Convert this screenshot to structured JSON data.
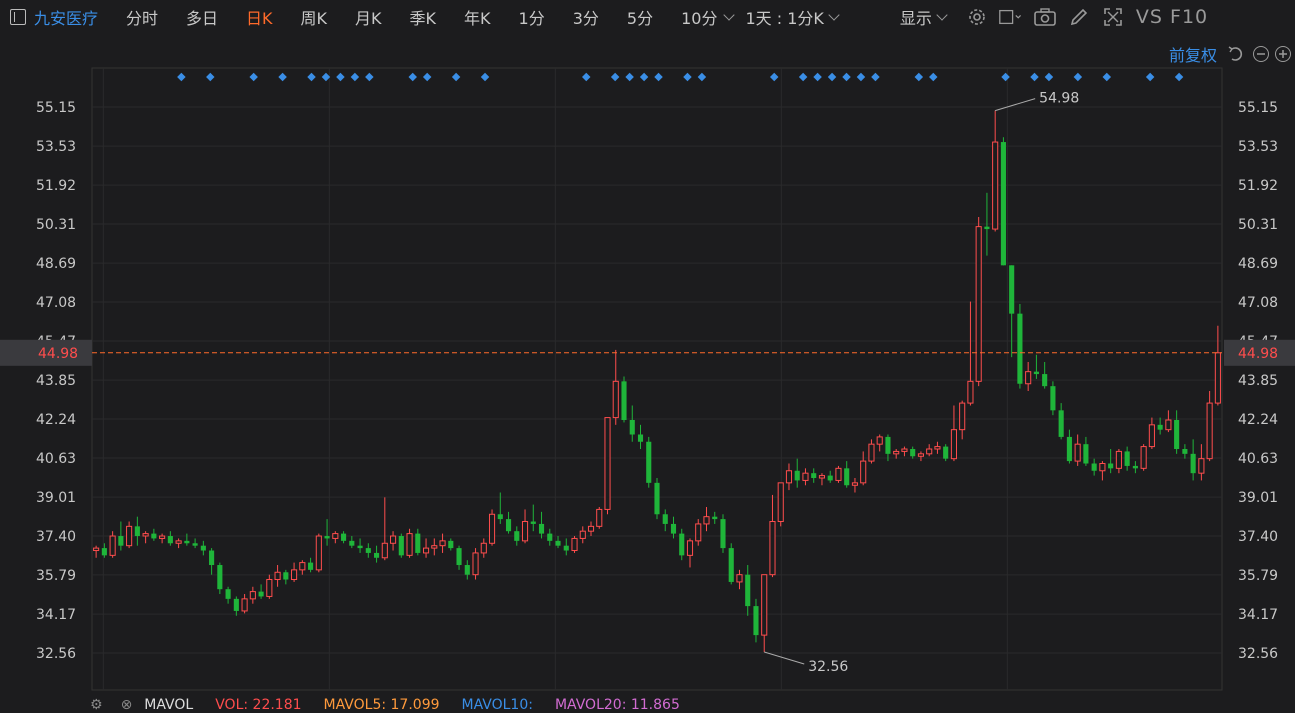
{
  "toolbar": {
    "stock_name": "九安医疗",
    "tabs": [
      "分时",
      "多日",
      "日K",
      "周K",
      "月K",
      "季K",
      "年K",
      "1分",
      "3分",
      "5分",
      "10分"
    ],
    "active_tab": "日K",
    "interval": "1天 : 1分K",
    "display": "显示",
    "f10": "VS F10"
  },
  "adjust": {
    "label": "前复权"
  },
  "colors": {
    "up": "#ff4d4d",
    "down": "#1fb53a",
    "marker": "#3a8ee6",
    "last": "#ff6a2a"
  },
  "volume_bar": {
    "mavol": "MAVOL",
    "vol": "VOL: 22.181",
    "mavol5": "MAVOL5: 17.099",
    "mavol10": "MAVOL10:",
    "mavol20": "MAVOL20: 11.865"
  },
  "chart_data": {
    "type": "candlestick",
    "y_ticks": [
      "55.15",
      "53.53",
      "51.92",
      "50.31",
      "48.69",
      "47.08",
      "45.47",
      "43.85",
      "42.24",
      "40.63",
      "39.01",
      "37.40",
      "35.79",
      "34.17",
      "32.56"
    ],
    "ylim": [
      32.56,
      55.15
    ],
    "last_price": "44.98",
    "high_label": "54.98",
    "low_label": "32.56",
    "vertical_grid_count": 5,
    "ohlc": [
      [
        36.8,
        37.0,
        36.5,
        36.9
      ],
      [
        36.9,
        37.1,
        36.5,
        36.6
      ],
      [
        36.6,
        37.6,
        36.5,
        37.4
      ],
      [
        37.4,
        38.0,
        36.8,
        37.0
      ],
      [
        37.0,
        38.0,
        36.9,
        37.8
      ],
      [
        37.8,
        38.2,
        37.0,
        37.4
      ],
      [
        37.4,
        37.6,
        37.1,
        37.5
      ],
      [
        37.5,
        37.7,
        37.2,
        37.3
      ],
      [
        37.3,
        37.5,
        37.1,
        37.4
      ],
      [
        37.4,
        37.6,
        37.0,
        37.1
      ],
      [
        37.1,
        37.3,
        36.9,
        37.2
      ],
      [
        37.2,
        37.5,
        37.0,
        37.1
      ],
      [
        37.1,
        37.3,
        36.9,
        37.0
      ],
      [
        37.0,
        37.2,
        36.6,
        36.8
      ],
      [
        36.8,
        36.9,
        35.8,
        36.2
      ],
      [
        36.2,
        36.3,
        35.0,
        35.2
      ],
      [
        35.2,
        35.3,
        34.6,
        34.8
      ],
      [
        34.8,
        34.9,
        34.1,
        34.3
      ],
      [
        34.3,
        35.0,
        34.2,
        34.8
      ],
      [
        34.8,
        35.3,
        34.6,
        35.1
      ],
      [
        35.1,
        35.4,
        34.8,
        34.9
      ],
      [
        34.9,
        35.8,
        34.8,
        35.6
      ],
      [
        35.6,
        36.2,
        35.3,
        35.9
      ],
      [
        35.9,
        36.0,
        35.4,
        35.6
      ],
      [
        35.6,
        36.3,
        35.5,
        36.0
      ],
      [
        36.0,
        36.4,
        35.8,
        36.3
      ],
      [
        36.3,
        36.5,
        35.9,
        36.0
      ],
      [
        36.0,
        37.5,
        35.9,
        37.4
      ],
      [
        37.4,
        38.1,
        37.0,
        37.3
      ],
      [
        37.3,
        37.6,
        37.1,
        37.5
      ],
      [
        37.5,
        37.6,
        37.1,
        37.2
      ],
      [
        37.2,
        37.4,
        36.9,
        37.0
      ],
      [
        37.0,
        37.3,
        36.7,
        36.9
      ],
      [
        36.9,
        37.1,
        36.5,
        36.7
      ],
      [
        36.7,
        37.0,
        36.3,
        36.5
      ],
      [
        36.5,
        39.0,
        36.4,
        37.1
      ],
      [
        37.1,
        37.6,
        36.8,
        37.4
      ],
      [
        37.4,
        37.5,
        36.5,
        36.6
      ],
      [
        36.6,
        37.7,
        36.5,
        37.5
      ],
      [
        37.5,
        37.7,
        36.6,
        36.7
      ],
      [
        36.7,
        37.3,
        36.5,
        36.9
      ],
      [
        36.9,
        37.3,
        36.6,
        37.0
      ],
      [
        37.0,
        37.5,
        36.7,
        37.2
      ],
      [
        37.2,
        37.3,
        36.8,
        36.9
      ],
      [
        36.9,
        37.0,
        36.0,
        36.2
      ],
      [
        36.2,
        36.4,
        35.6,
        35.8
      ],
      [
        35.8,
        36.9,
        35.6,
        36.7
      ],
      [
        36.7,
        37.3,
        36.5,
        37.1
      ],
      [
        37.1,
        38.5,
        37.0,
        38.3
      ],
      [
        38.3,
        39.2,
        37.9,
        38.1
      ],
      [
        38.1,
        38.4,
        37.5,
        37.6
      ],
      [
        37.6,
        37.8,
        37.0,
        37.2
      ],
      [
        37.2,
        38.5,
        37.1,
        38.0
      ],
      [
        38.0,
        38.7,
        37.6,
        37.9
      ],
      [
        37.9,
        38.4,
        37.3,
        37.5
      ],
      [
        37.5,
        37.7,
        37.0,
        37.2
      ],
      [
        37.2,
        37.4,
        36.9,
        37.0
      ],
      [
        37.0,
        37.3,
        36.6,
        36.8
      ],
      [
        36.8,
        37.4,
        36.7,
        37.3
      ],
      [
        37.3,
        37.8,
        37.1,
        37.6
      ],
      [
        37.6,
        38.0,
        37.4,
        37.8
      ],
      [
        37.8,
        38.6,
        37.7,
        38.5
      ],
      [
        38.5,
        40.2,
        38.3,
        42.3
      ],
      [
        42.3,
        45.1,
        42.0,
        43.8
      ],
      [
        43.8,
        44.0,
        42.1,
        42.2
      ],
      [
        42.2,
        42.8,
        41.3,
        41.6
      ],
      [
        41.6,
        42.0,
        41.0,
        41.3
      ],
      [
        41.3,
        41.5,
        39.4,
        39.6
      ],
      [
        39.6,
        39.8,
        38.1,
        38.3
      ],
      [
        38.3,
        38.5,
        37.6,
        37.9
      ],
      [
        37.9,
        38.2,
        37.3,
        37.5
      ],
      [
        37.5,
        37.7,
        36.4,
        36.6
      ],
      [
        36.6,
        37.3,
        36.1,
        37.2
      ],
      [
        37.2,
        38.1,
        37.0,
        37.9
      ],
      [
        37.9,
        38.6,
        37.6,
        38.2
      ],
      [
        38.2,
        38.4,
        37.9,
        38.1
      ],
      [
        38.1,
        38.3,
        36.7,
        36.9
      ],
      [
        36.9,
        37.1,
        35.4,
        35.5
      ],
      [
        35.5,
        36.0,
        35.2,
        35.8
      ],
      [
        35.8,
        36.2,
        34.1,
        34.5
      ],
      [
        34.5,
        34.8,
        33.0,
        33.3
      ],
      [
        33.3,
        35.8,
        32.6,
        35.8
      ],
      [
        35.8,
        39.1,
        35.7,
        38.0
      ],
      [
        38.0,
        39.6,
        37.8,
        39.6
      ],
      [
        39.6,
        40.4,
        39.3,
        40.1
      ],
      [
        40.1,
        40.6,
        39.4,
        39.7
      ],
      [
        39.7,
        40.2,
        39.5,
        40.0
      ],
      [
        40.0,
        40.2,
        39.6,
        39.8
      ],
      [
        39.8,
        40.0,
        39.5,
        39.9
      ],
      [
        39.9,
        40.1,
        39.6,
        39.7
      ],
      [
        39.7,
        40.3,
        39.6,
        40.2
      ],
      [
        40.2,
        40.5,
        39.4,
        39.5
      ],
      [
        39.5,
        39.8,
        39.2,
        39.6
      ],
      [
        39.6,
        40.9,
        39.5,
        40.5
      ],
      [
        40.5,
        41.4,
        40.4,
        41.2
      ],
      [
        41.2,
        41.6,
        40.9,
        41.5
      ],
      [
        41.5,
        41.6,
        40.5,
        40.8
      ],
      [
        40.8,
        41.0,
        40.6,
        40.9
      ],
      [
        40.9,
        41.1,
        40.7,
        41.0
      ],
      [
        41.0,
        41.1,
        40.6,
        40.7
      ],
      [
        40.7,
        40.9,
        40.5,
        40.8
      ],
      [
        40.8,
        41.2,
        40.7,
        41.0
      ],
      [
        41.0,
        41.3,
        40.8,
        41.1
      ],
      [
        41.1,
        41.2,
        40.5,
        40.6
      ],
      [
        40.6,
        42.8,
        40.5,
        41.8
      ],
      [
        41.8,
        43.0,
        41.4,
        42.9
      ],
      [
        42.9,
        47.1,
        42.8,
        43.8
      ],
      [
        43.8,
        50.6,
        43.6,
        50.2
      ],
      [
        50.2,
        51.6,
        49.0,
        50.1
      ],
      [
        50.1,
        55.0,
        50.0,
        53.7
      ],
      [
        53.7,
        53.9,
        48.7,
        48.6
      ],
      [
        48.6,
        47.8,
        44.8,
        46.6
      ],
      [
        46.6,
        47.0,
        43.5,
        43.7
      ],
      [
        43.7,
        44.6,
        43.4,
        44.2
      ],
      [
        44.2,
        44.9,
        43.9,
        44.1
      ],
      [
        44.1,
        44.6,
        43.5,
        43.6
      ],
      [
        43.6,
        43.8,
        42.4,
        42.6
      ],
      [
        42.6,
        42.9,
        41.4,
        41.5
      ],
      [
        41.5,
        41.8,
        40.4,
        40.5
      ],
      [
        40.5,
        41.6,
        40.3,
        41.2
      ],
      [
        41.2,
        41.5,
        40.3,
        40.4
      ],
      [
        40.4,
        40.6,
        39.9,
        40.1
      ],
      [
        40.1,
        40.5,
        39.7,
        40.4
      ],
      [
        40.4,
        41.0,
        40.0,
        40.2
      ],
      [
        40.2,
        41.0,
        40.0,
        40.9
      ],
      [
        40.9,
        41.1,
        40.1,
        40.3
      ],
      [
        40.3,
        40.5,
        40.0,
        40.2
      ],
      [
        40.2,
        41.2,
        40.1,
        41.1
      ],
      [
        41.1,
        42.3,
        41.0,
        42.0
      ],
      [
        42.0,
        42.3,
        41.6,
        41.8
      ],
      [
        41.8,
        42.6,
        41.7,
        42.2
      ],
      [
        42.2,
        42.6,
        40.8,
        41.0
      ],
      [
        41.0,
        41.2,
        40.6,
        40.8
      ],
      [
        40.8,
        41.4,
        39.7,
        40.0
      ],
      [
        40.0,
        41.2,
        39.7,
        40.6
      ],
      [
        40.6,
        43.4,
        40.5,
        42.9
      ],
      [
        42.9,
        46.1,
        42.8,
        44.98
      ]
    ],
    "marker_indices": [
      3,
      5,
      8,
      10,
      12,
      13,
      14,
      15,
      16,
      19,
      20,
      22,
      24,
      31,
      33,
      34,
      35,
      36,
      38,
      39,
      44,
      46,
      47,
      48,
      49,
      50,
      51,
      54,
      55,
      60,
      62,
      63,
      65,
      67,
      70,
      72,
      73
    ]
  }
}
